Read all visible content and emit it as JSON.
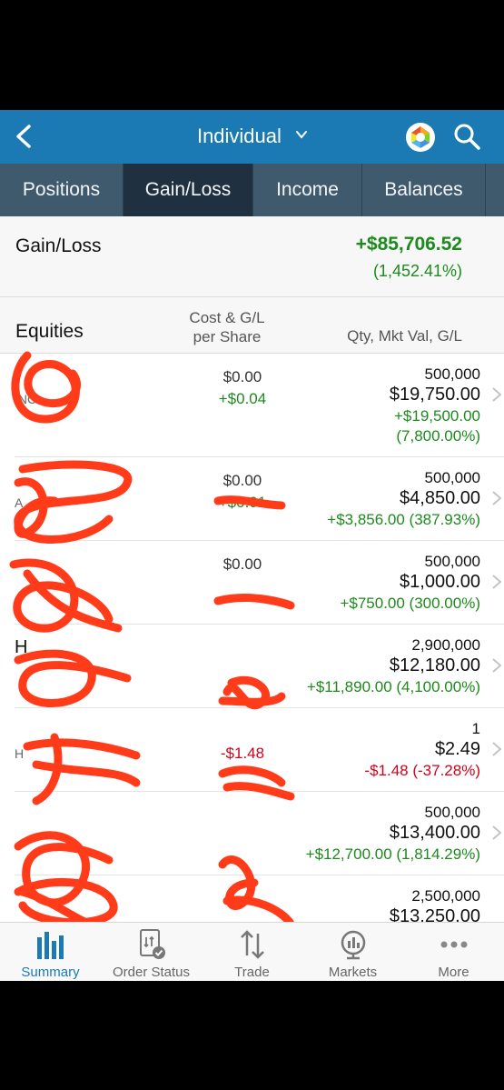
{
  "nav": {
    "title": "Individual",
    "accent": "#1b79b3"
  },
  "tabs": [
    {
      "label": "Positions",
      "active": false
    },
    {
      "label": "Gain/Loss",
      "active": true
    },
    {
      "label": "Income",
      "active": false
    },
    {
      "label": "Balances",
      "active": false
    }
  ],
  "summary": {
    "label": "Gain/Loss",
    "total": "+$85,706.52",
    "percent": "(1,452.41%)"
  },
  "columns": {
    "section": "Equities",
    "cost_line1": "Cost & G/L",
    "cost_line2": "per Share",
    "right": "Qty, Mkt Val, G/L"
  },
  "rows": [
    {
      "symbol": "",
      "name": "INC",
      "cost": "$0.00",
      "cost_gl": "+$0.04",
      "qty": "500,000",
      "mkt_val": "$19,750.00",
      "gl": "+$19,500.00",
      "gl_pct": "(7,800.00%)"
    },
    {
      "symbol": "",
      "name": "A",
      "cost": "$0.00",
      "cost_gl": "+$0.01",
      "qty": "500,000",
      "mkt_val": "$4,850.00",
      "gl": "+$3,856.00 (387.93%)",
      "gl_pct": ""
    },
    {
      "symbol": "",
      "name": "",
      "cost": "$0.00",
      "cost_gl": "",
      "qty": "500,000",
      "mkt_val": "$1,000.00",
      "gl": "+$750.00 (300.00%)",
      "gl_pct": ""
    },
    {
      "symbol": "H",
      "name": "",
      "cost": "",
      "cost_gl": "",
      "qty": "2,900,000",
      "mkt_val": "$12,180.00",
      "gl": "+$11,890.00 (4,100.00%)",
      "gl_pct": ""
    },
    {
      "symbol": "",
      "name": "H",
      "cost": "",
      "cost_gl": "-$1.48",
      "qty": "1",
      "mkt_val": "$2.49",
      "gl": "-$1.48 (-37.28%)",
      "gl_pct": ""
    },
    {
      "symbol": "",
      "name": "",
      "cost": "",
      "cost_gl": "",
      "qty": "500,000",
      "mkt_val": "$13,400.00",
      "gl": "+$12,700.00 (1,814.29%)",
      "gl_pct": ""
    },
    {
      "symbol": "",
      "name": "",
      "cost": "",
      "cost_gl": "",
      "qty": "2,500,000",
      "mkt_val": "$13,250.00",
      "gl": "",
      "gl_pct": ""
    }
  ],
  "bottom_nav": [
    {
      "label": "Summary",
      "icon": "bar-chart-icon",
      "active": true
    },
    {
      "label": "Order Status",
      "icon": "order-status-icon",
      "active": false
    },
    {
      "label": "Trade",
      "icon": "trade-arrows-icon",
      "active": false
    },
    {
      "label": "Markets",
      "icon": "markets-globe-icon",
      "active": false
    },
    {
      "label": "More",
      "icon": "more-dots-icon",
      "active": false
    }
  ],
  "colors": {
    "positive": "#1d8a1d",
    "negative": "#d0021b",
    "redaction": "#ff3b1a"
  }
}
